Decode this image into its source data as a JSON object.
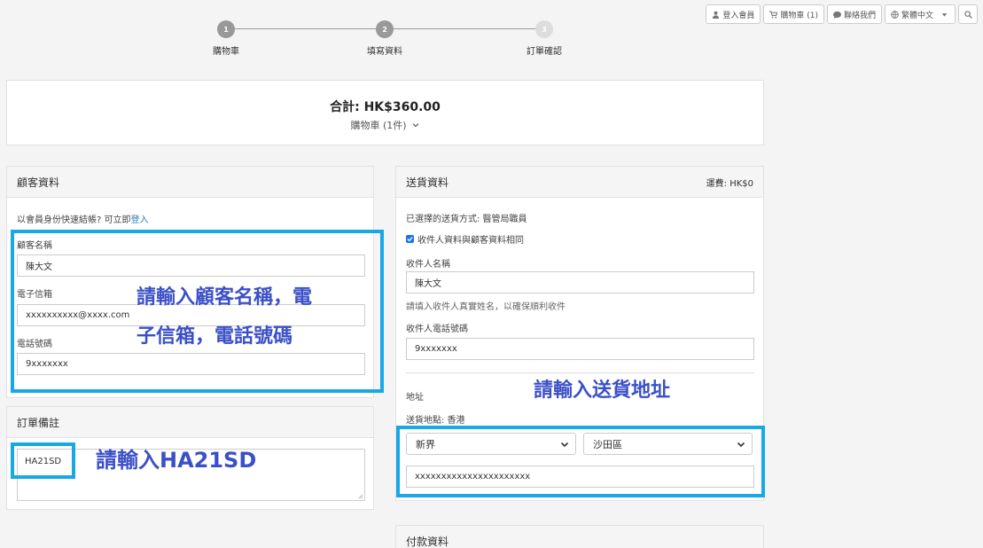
{
  "toolbar": {
    "login": "登入會員",
    "cart": "購物車 (1)",
    "contact": "聯絡我們",
    "language": "繁體中文"
  },
  "steps": [
    {
      "number": "1",
      "label": "購物車"
    },
    {
      "number": "2",
      "label": "填寫資料"
    },
    {
      "number": "3",
      "label": "訂單確認"
    }
  ],
  "summary": {
    "total": "合計: HK$360.00",
    "cart_toggle": "購物車 (1件)"
  },
  "customer": {
    "title": "顧客資料",
    "member_prompt": "以會員身份快速結帳? 可立即",
    "login_link": "登入",
    "name_label": "顧客名稱",
    "name_value": "陳大文",
    "email_label": "電子信箱",
    "email_value": "xxxxxxxxxx@xxxx.com",
    "phone_label": "電話號碼",
    "phone_value": "9xxxxxxx"
  },
  "order_note": {
    "title": "訂單備註",
    "value": "HA21SD"
  },
  "delivery": {
    "title": "送貨資料",
    "shipping_fee": "運費: HK$0",
    "method": "已選擇的送貨方式: 醫管局職員",
    "same_as_customer": "收件人資料與顧客資料相同",
    "recipient_name_label": "收件人名稱",
    "recipient_name_value": "陳大文",
    "recipient_name_hint": "請填入收件人真實姓名，以確保順利收件",
    "recipient_phone_label": "收件人電話號碼",
    "recipient_phone_value": "9xxxxxxx",
    "address_label": "地址",
    "address_location": "送貨地點: 香港",
    "region": "新界",
    "district": "沙田區",
    "address_value": "xxxxxxxxxxxxxxxxxxxxxx"
  },
  "payment": {
    "title": "付款資料"
  },
  "annotations": {
    "customer_note_line1": "請輸入顧客名稱，電",
    "customer_note_line2": "子信箱，電話號碼",
    "address_note": "請輸入送貨地址",
    "order_note": "請輸入HA21SD"
  },
  "colors": {
    "highlight": "#19a8e6",
    "annotation_text": "#3b50c8",
    "link": "#2a7ab0"
  }
}
